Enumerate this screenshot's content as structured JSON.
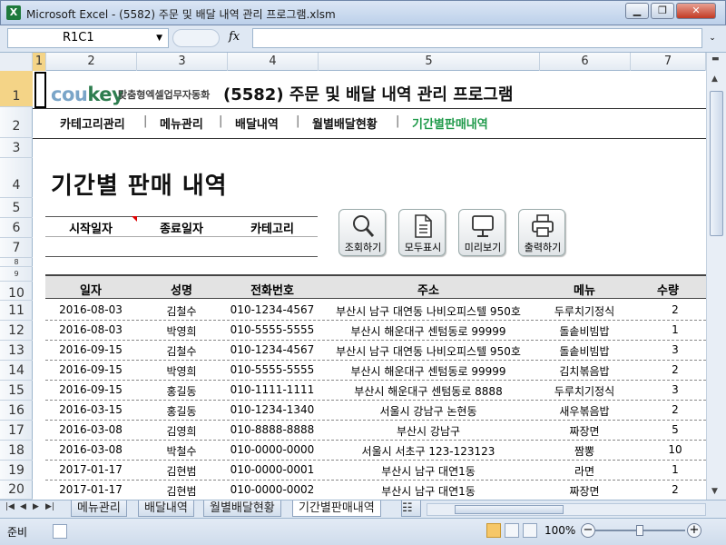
{
  "window": {
    "title": "Microsoft Excel - (5582) 주문 및 배달 내역 관리 프로그램.xlsm",
    "app_icon": "X"
  },
  "formula_bar": {
    "name_box": "R1C1",
    "fx_label": "fx",
    "formula": ""
  },
  "columns": [
    "1",
    "2",
    "3",
    "4",
    "5",
    "6",
    "7"
  ],
  "rows": [
    "1",
    "2",
    "3",
    "4",
    "5",
    "6",
    "7",
    "8",
    "9",
    "10",
    "11",
    "12",
    "13",
    "14",
    "15",
    "16",
    "17",
    "18",
    "19",
    "20"
  ],
  "header": {
    "logo_main": "cou",
    "logo_accent": "key",
    "logo_sub": "맞춤형엑셀업무자동화",
    "program_title": "(5582) 주문 및 배달 내역 관리 프로그램"
  },
  "menu": [
    {
      "label": "카테고리관리",
      "active": false
    },
    {
      "label": "메뉴관리",
      "active": false
    },
    {
      "label": "배달내역",
      "active": false
    },
    {
      "label": "월별배달현황",
      "active": false
    },
    {
      "label": "기간별판매내역",
      "active": true
    }
  ],
  "menu_separator": "|",
  "page_title": "기간별 판매 내역",
  "filter": {
    "start_label": "시작일자",
    "end_label": "종료일자",
    "category_label": "카테고리"
  },
  "toolbar": {
    "search_label": "조회하기",
    "show_all_label": "모두표시",
    "preview_label": "미리보기",
    "print_label": "출력하기"
  },
  "table": {
    "headers": [
      "일자",
      "성명",
      "전화번호",
      "주소",
      "메뉴",
      "수량"
    ],
    "rows": [
      [
        "2016-08-03",
        "김철수",
        "010-1234-4567",
        "부산시 남구 대연동 나비오피스텔 950호",
        "두루치기정식",
        "2"
      ],
      [
        "2016-08-03",
        "박영희",
        "010-5555-5555",
        "부산시 해운대구 센텀동로 99999",
        "돌솥비빔밥",
        "1"
      ],
      [
        "2016-09-15",
        "김철수",
        "010-1234-4567",
        "부산시 남구 대연동 나비오피스텔 950호",
        "돌솥비빔밥",
        "3"
      ],
      [
        "2016-09-15",
        "박영희",
        "010-5555-5555",
        "부산시 해운대구 센텀동로 99999",
        "김치볶음밥",
        "2"
      ],
      [
        "2016-09-15",
        "홍길동",
        "010-1111-1111",
        "부산시 해운대구 센텀동로 8888",
        "두루치기정식",
        "3"
      ],
      [
        "2016-03-15",
        "홍길동",
        "010-1234-1340",
        "서울시 강남구 논현동",
        "새우볶음밥",
        "2"
      ],
      [
        "2016-03-08",
        "김영희",
        "010-8888-8888",
        "부산시 강남구",
        "짜장면",
        "5"
      ],
      [
        "2016-03-08",
        "박철수",
        "010-0000-0000",
        "서울시 서초구 123-123123",
        "짬뽕",
        "10"
      ],
      [
        "2017-01-17",
        "김현범",
        "010-0000-0001",
        "부산시 남구 대연1동",
        "라면",
        "1"
      ],
      [
        "2017-01-17",
        "김현범",
        "010-0000-0002",
        "부산시 남구 대연1동",
        "짜장면",
        "2"
      ]
    ]
  },
  "sheet_tabs": [
    {
      "label": "메뉴관리",
      "active": false
    },
    {
      "label": "배달내역",
      "active": false
    },
    {
      "label": "월별배달현황",
      "active": false
    },
    {
      "label": "기간별판매내역",
      "active": true
    }
  ],
  "status_bar": {
    "ready": "준비",
    "zoom": "100%"
  },
  "colors": {
    "active_menu": "#1f9a4a",
    "logo_key": "#2e7d4f",
    "logo_cou": "#7aa5c8"
  }
}
